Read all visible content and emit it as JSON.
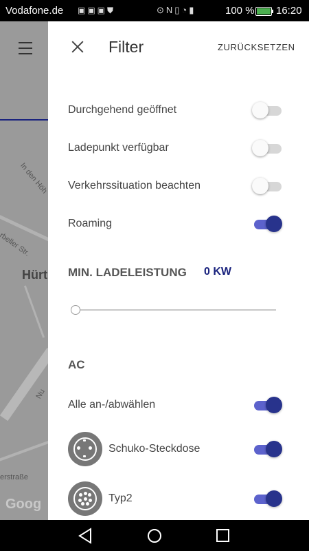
{
  "status_bar": {
    "carrier": "Vodafone.de",
    "battery_percent": "100 %",
    "time": "16:20"
  },
  "map": {
    "town": "Hürt",
    "street_labels": [
      "In den Höh",
      "rbeller Str.",
      "Nu",
      "erstraße"
    ],
    "google_mark": "Goog"
  },
  "header": {
    "title": "Filter",
    "reset_label": "ZURÜCKSETZEN"
  },
  "filters": [
    {
      "label": "Durchgehend geöffnet",
      "enabled": false
    },
    {
      "label": "Ladepunkt verfügbar",
      "enabled": false
    },
    {
      "label": "Verkehrssituation beachten",
      "enabled": false
    },
    {
      "label": "Roaming",
      "enabled": true
    }
  ],
  "min_power": {
    "label": "MIN. LADELEISTUNG",
    "value": "0 KW",
    "slider_fraction": 0
  },
  "ac": {
    "heading": "AC",
    "select_all": {
      "label": "Alle an-/abwählen",
      "enabled": true
    },
    "connectors": [
      {
        "label": "Schuko-Steckdose",
        "enabled": true,
        "icon": "schuko-plug-icon"
      },
      {
        "label": "Typ2",
        "enabled": true,
        "icon": "type2-plug-icon"
      }
    ]
  }
}
